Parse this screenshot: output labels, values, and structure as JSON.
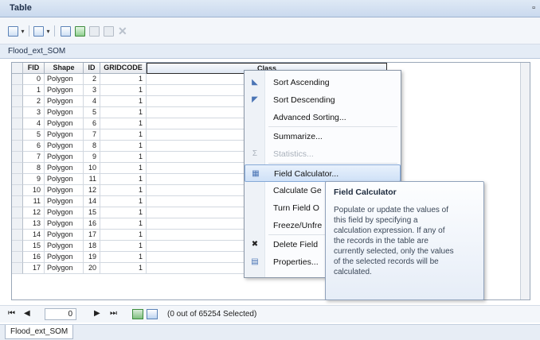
{
  "window": {
    "title": "Table",
    "restore_glyph": "▫"
  },
  "toolbar": {
    "buttons": [
      {
        "icon": "table-options-icon"
      },
      {
        "icon": "related-tables-icon"
      },
      {
        "icon": "select-by-attributes-icon"
      },
      {
        "icon": "switch-selection-icon"
      },
      {
        "icon": "clear-selection-icon"
      },
      {
        "icon": "zoom-to-selected-icon"
      },
      {
        "icon": "delete-selected-icon"
      }
    ],
    "delete_glyph": "✕"
  },
  "table_name": "Flood_ext_SOM",
  "columns": [
    "FID",
    "Shape",
    "ID",
    "GRIDCODE",
    "Class"
  ],
  "rows": [
    {
      "fid": "0",
      "shape": "Polygon",
      "id": "2",
      "gridcode": "1"
    },
    {
      "fid": "1",
      "shape": "Polygon",
      "id": "3",
      "gridcode": "1"
    },
    {
      "fid": "2",
      "shape": "Polygon",
      "id": "4",
      "gridcode": "1"
    },
    {
      "fid": "3",
      "shape": "Polygon",
      "id": "5",
      "gridcode": "1"
    },
    {
      "fid": "4",
      "shape": "Polygon",
      "id": "6",
      "gridcode": "1"
    },
    {
      "fid": "5",
      "shape": "Polygon",
      "id": "7",
      "gridcode": "1"
    },
    {
      "fid": "6",
      "shape": "Polygon",
      "id": "8",
      "gridcode": "1"
    },
    {
      "fid": "7",
      "shape": "Polygon",
      "id": "9",
      "gridcode": "1"
    },
    {
      "fid": "8",
      "shape": "Polygon",
      "id": "10",
      "gridcode": "1"
    },
    {
      "fid": "9",
      "shape": "Polygon",
      "id": "11",
      "gridcode": "1"
    },
    {
      "fid": "10",
      "shape": "Polygon",
      "id": "12",
      "gridcode": "1"
    },
    {
      "fid": "11",
      "shape": "Polygon",
      "id": "14",
      "gridcode": "1"
    },
    {
      "fid": "12",
      "shape": "Polygon",
      "id": "15",
      "gridcode": "1"
    },
    {
      "fid": "13",
      "shape": "Polygon",
      "id": "16",
      "gridcode": "1"
    },
    {
      "fid": "14",
      "shape": "Polygon",
      "id": "17",
      "gridcode": "1"
    },
    {
      "fid": "15",
      "shape": "Polygon",
      "id": "18",
      "gridcode": "1"
    },
    {
      "fid": "16",
      "shape": "Polygon",
      "id": "19",
      "gridcode": "1"
    },
    {
      "fid": "17",
      "shape": "Polygon",
      "id": "20",
      "gridcode": "1"
    }
  ],
  "context_menu": {
    "items": [
      {
        "label": "Sort Ascending",
        "icon": "sort-ascending-icon",
        "glyph": "◣"
      },
      {
        "label": "Sort Descending",
        "icon": "sort-descending-icon",
        "glyph": "◤"
      },
      {
        "label": "Advanced Sorting...",
        "icon": "",
        "glyph": ""
      },
      {
        "label": "Summarize...",
        "icon": "",
        "glyph": ""
      },
      {
        "label": "Statistics...",
        "icon": "statistics-icon",
        "glyph": "Σ",
        "disabled": true
      },
      {
        "label": "Field Calculator...",
        "icon": "field-calculator-icon",
        "glyph": "▦",
        "highlighted": true
      },
      {
        "label": "Calculate Ge",
        "icon": "",
        "glyph": ""
      },
      {
        "label": "Turn Field O",
        "icon": "",
        "glyph": ""
      },
      {
        "label": "Freeze/Unfre",
        "icon": "",
        "glyph": ""
      },
      {
        "label": "Delete Field",
        "icon": "delete-field-icon",
        "glyph": "✖"
      },
      {
        "label": "Properties...",
        "icon": "properties-icon",
        "glyph": "▤"
      }
    ]
  },
  "tooltip": {
    "title": "Field Calculator",
    "lines": [
      "Populate or update the values of",
      "this field by specifying a",
      "calculation expression. If any of",
      "the records in the table are",
      "currently selected, only the values",
      "of the selected records will be",
      "calculated."
    ]
  },
  "navigation": {
    "first": "⏮",
    "prev": "◀",
    "current": "0",
    "next": "▶",
    "last": "⏭",
    "status": "(0 out of 65254 Selected)"
  },
  "bottom_tab": "Flood_ext_SOM",
  "colors": {
    "accent": "#cfe1f7",
    "title_bg": "#c9d9ee"
  }
}
